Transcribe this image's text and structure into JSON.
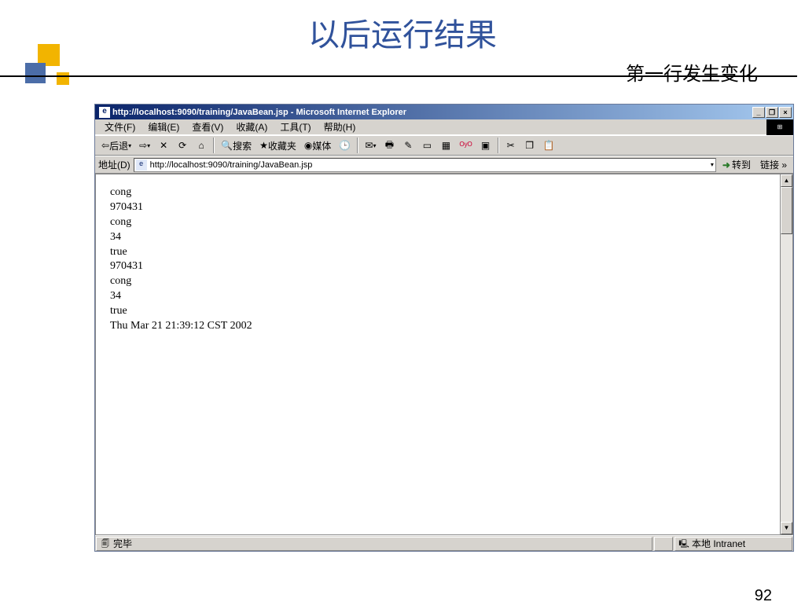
{
  "slide": {
    "title": "以后运行结果",
    "subtitle": "第一行发生变化",
    "page_number": "92"
  },
  "browser": {
    "window_title": "http://localhost:9090/training/JavaBean.jsp - Microsoft Internet Explorer",
    "menus": {
      "file": "文件(F)",
      "edit": "编辑(E)",
      "view": "查看(V)",
      "favorites": "收藏(A)",
      "tools": "工具(T)",
      "help": "帮助(H)"
    },
    "toolbar": {
      "back": "后退",
      "search": "搜索",
      "favorites": "收藏夹",
      "media": "媒体"
    },
    "addressbar": {
      "label": "地址(D)",
      "url": "http://localhost:9090/training/JavaBean.jsp",
      "go": "转到",
      "links": "链接"
    },
    "status": {
      "done": "完毕",
      "zone": "本地 Intranet"
    },
    "page_lines": [
      "cong",
      "970431",
      "cong",
      "34",
      "true",
      "970431",
      "cong",
      "34",
      "true",
      "Thu Mar 21 21:39:12 CST 2002"
    ]
  }
}
